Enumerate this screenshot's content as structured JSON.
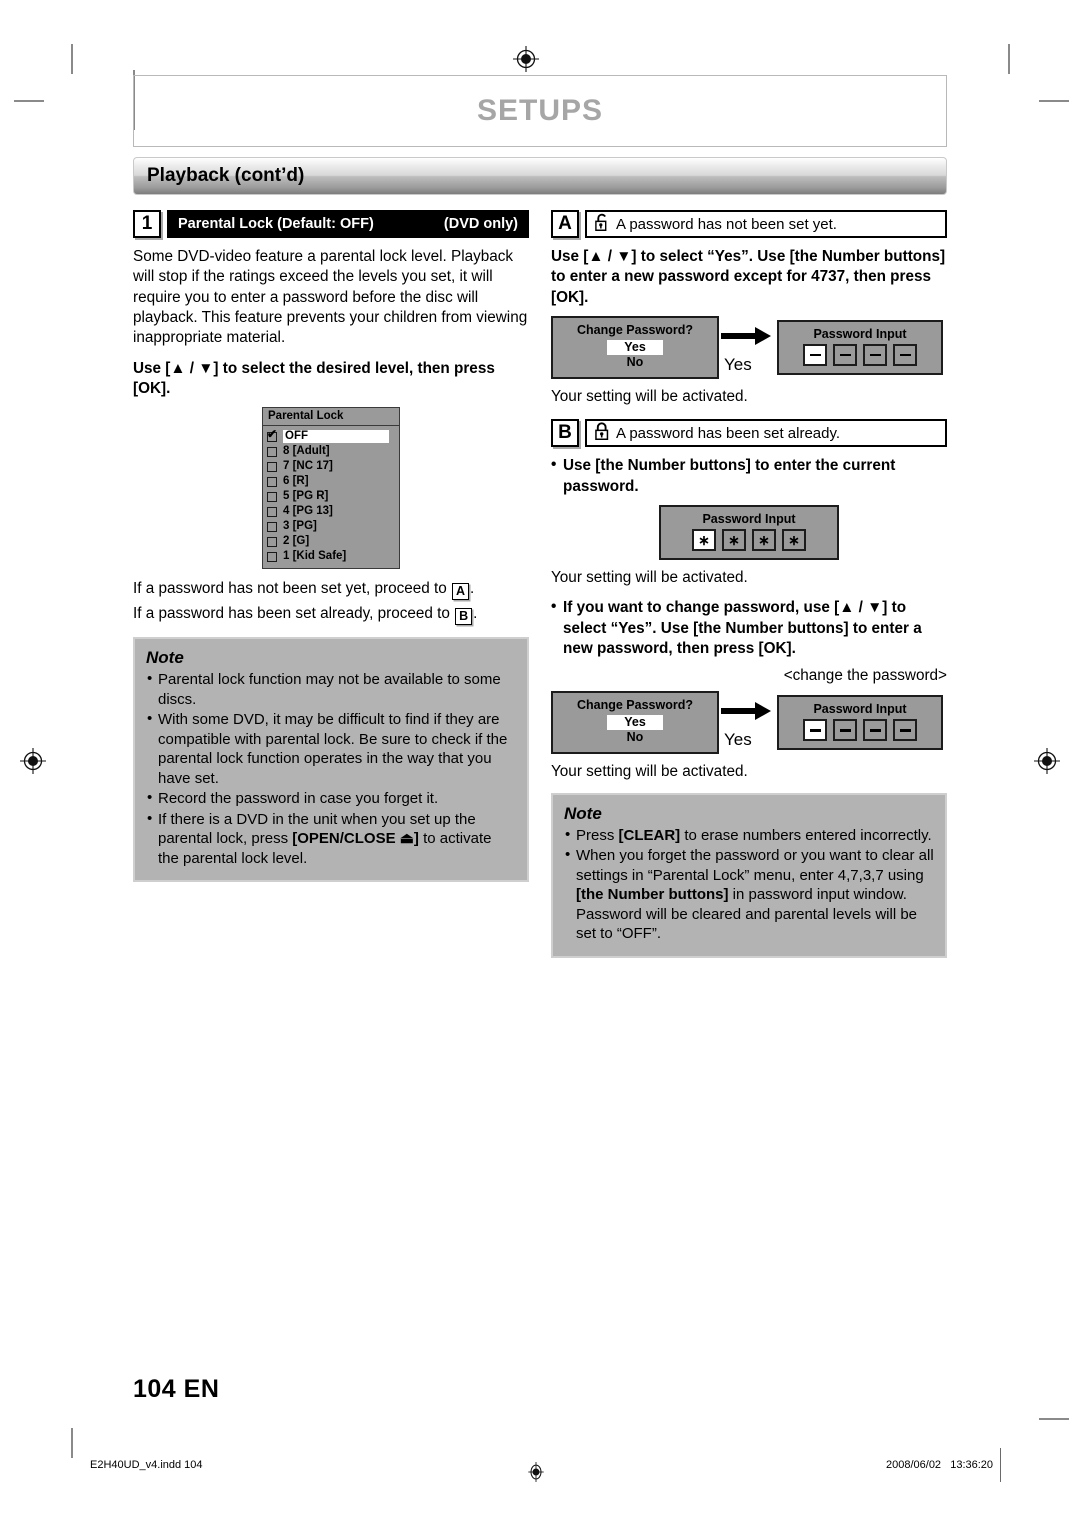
{
  "header": {
    "title": "SETUPS",
    "section_bar": "Playback (cont’d)"
  },
  "step1": {
    "badge": "1",
    "title": "Parental Lock (Default: OFF)",
    "tag": "(DVD only)",
    "intro": "Some DVD-video feature a parental lock level. Playback will stop if the ratings exceed the levels you set, it will require you to enter a password before the disc will playback. This feature prevents your children from viewing inappropriate material.",
    "instruction": "Use [▲ / ▼] to select the desired level, then press [OK].",
    "after_a_prefix": "If a password has not been set yet, proceed to ",
    "after_a_badge": "A",
    "after_a_suffix": ".",
    "after_b_prefix": "If a password has been set already, proceed to ",
    "after_b_badge": "B",
    "after_b_suffix": "."
  },
  "osd_parental": {
    "title": "Parental Lock",
    "items": [
      {
        "label": "OFF",
        "checked": true,
        "selected": true
      },
      {
        "label": "8 [Adult]",
        "checked": false,
        "selected": false
      },
      {
        "label": "7 [NC 17]",
        "checked": false,
        "selected": false
      },
      {
        "label": "6 [R]",
        "checked": false,
        "selected": false
      },
      {
        "label": "5 [PG R]",
        "checked": false,
        "selected": false
      },
      {
        "label": "4 [PG 13]",
        "checked": false,
        "selected": false
      },
      {
        "label": "3 [PG]",
        "checked": false,
        "selected": false
      },
      {
        "label": "2 [G]",
        "checked": false,
        "selected": false
      },
      {
        "label": "1 [Kid Safe]",
        "checked": false,
        "selected": false
      }
    ]
  },
  "note_left": {
    "title": "Note",
    "items": [
      "Parental lock function may not be available to some discs.",
      "With some DVD, it may be difficult to find if they are compatible with parental lock. Be sure to check if the parental lock function operates in the way that you have set.",
      "Record the password in case you forget it.",
      "If there is a DVD in the unit when you set up the parental lock, press [OPEN/CLOSE ▲] to activate the parental lock level."
    ],
    "item4_plain_1": "If there is a DVD in the unit when you set up the parental lock, press ",
    "item4_bold": "[OPEN/CLOSE ⏏]",
    "item4_plain_2": " to activate the parental lock level."
  },
  "sectionA": {
    "badge": "A",
    "icon": "unlocked-padlock-icon",
    "title": "A password has not been set yet.",
    "instruction": "Use [▲ / ▼] to select “Yes”. Use [the Number buttons] to enter a new password except for 4737, then press [OK].",
    "activated": "Your setting will be activated."
  },
  "sectionB": {
    "badge": "B",
    "icon": "locked-padlock-icon",
    "title": "A password has been set already.",
    "bullet1": "Use [the Number buttons] to enter the current password.",
    "activated1": "Your setting will be activated.",
    "bullet2": "If you want to change password, use [▲ / ▼] to select “Yes”. Use [the Number buttons] to enter a new password, then press [OK].",
    "change_caption": "<change the password>",
    "activated2": "Your setting will be activated."
  },
  "flow_a": {
    "dialog_title": "Change Password?",
    "yes": "Yes",
    "no": "No",
    "arrow_label": "Yes",
    "input_title": "Password Input",
    "cells": [
      "—",
      "—",
      "—",
      "—"
    ]
  },
  "flow_b_current": {
    "input_title": "Password Input",
    "cells": [
      "∗",
      "∗",
      "∗",
      "∗"
    ]
  },
  "flow_b_change": {
    "dialog_title": "Change Password?",
    "yes": "Yes",
    "no": "No",
    "arrow_label": "Yes",
    "input_title": "Password Input",
    "cells": [
      "—",
      "—",
      "—",
      "—"
    ]
  },
  "note_right": {
    "title": "Note",
    "item1_plain_1": "Press ",
    "item1_bold": "[CLEAR]",
    "item1_plain_2": " to erase numbers entered incorrectly.",
    "item2_plain_1": "When you forget the password or you want to clear all settings in “Parental Lock” menu, enter 4,7,3,7 using ",
    "item2_bold": "[the Number buttons]",
    "item2_plain_2": " in password input window. Password will be cleared and parental levels will be set to “OFF”."
  },
  "footer": {
    "page_number": "104  EN",
    "file": "E2H40UD_v4.indd   104",
    "date": "2008/06/02   13:36:20"
  },
  "colors": {
    "osd_gray": "#9a9a9a",
    "note_gray": "#b3b3b3",
    "setups_title_gray": "#a6a6a6"
  }
}
